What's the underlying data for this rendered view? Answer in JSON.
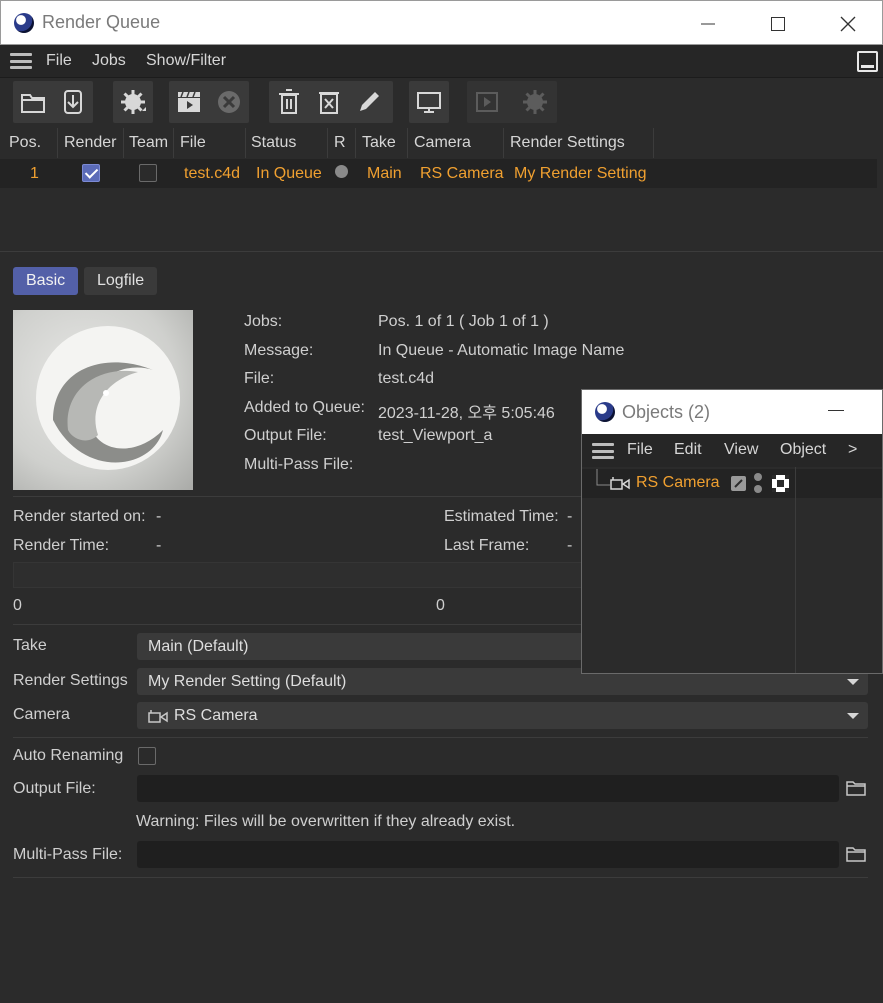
{
  "window": {
    "title": "Render Queue"
  },
  "menubar": {
    "items": [
      "File",
      "Jobs",
      "Show/Filter"
    ]
  },
  "toolbar": {
    "icons": [
      "folder-icon",
      "download-icon",
      "gear-icon",
      "clapper-icon",
      "stop-icon",
      "trash-icon",
      "delete-job-icon",
      "pencil-icon",
      "monitor-icon",
      "play-viewer-icon",
      "gear-disabled-icon"
    ]
  },
  "table": {
    "headers": [
      "Pos.",
      "Render",
      "Team",
      "File",
      "Status",
      "R",
      "Take",
      "Camera",
      "Render Settings"
    ],
    "rows": [
      {
        "pos": "1",
        "render": true,
        "team": false,
        "file": "test.c4d",
        "status": "In Queue",
        "take": "Main",
        "camera": "RS Camera",
        "render_settings": "My Render Setting"
      }
    ]
  },
  "tabs": {
    "basic": "Basic",
    "logfile": "Logfile"
  },
  "info": {
    "jobs_label": "Jobs:",
    "jobs_value": "Pos. 1 of 1 ( Job 1 of 1 )",
    "message_label": "Message:",
    "message_value": "In Queue - Automatic Image Name",
    "file_label": "File:",
    "file_value": "test.c4d",
    "added_label": "Added to Queue:",
    "added_value": "2023-11-28, 오후 5:05:46",
    "output_label": "Output File:",
    "output_value": "test_Viewport_a",
    "multipass_label": "Multi-Pass File:"
  },
  "stats": {
    "render_started_label": "Render started on:",
    "render_started_value": "-",
    "render_time_label": "Render Time:",
    "render_time_value": "-",
    "estimated_label": "Estimated Time:",
    "estimated_value": "-",
    "last_frame_label": "Last Frame:",
    "last_frame_value": "-",
    "progress_left": "0",
    "progress_right": "0"
  },
  "form": {
    "take_label": "Take",
    "take_value": "Main (Default)",
    "render_settings_label": "Render Settings",
    "render_settings_value": "My Render Setting (Default)",
    "camera_label": "Camera",
    "camera_value": "RS Camera",
    "auto_renaming_label": "Auto Renaming",
    "auto_renaming": false,
    "output_file_label": "Output File:",
    "output_file_value": "",
    "warning": "Warning: Files will be overwritten if they already exist.",
    "multipass_label": "Multi-Pass File:",
    "multipass_value": ""
  },
  "objects_panel": {
    "title": "Objects (2)",
    "menu": [
      "File",
      "Edit",
      "View",
      "Object"
    ],
    "more": ">",
    "items": [
      {
        "name": "RS Camera"
      }
    ]
  },
  "colors": {
    "accent": "#5360a8",
    "highlight": "#f0a030",
    "background": "#2b2b2b"
  }
}
